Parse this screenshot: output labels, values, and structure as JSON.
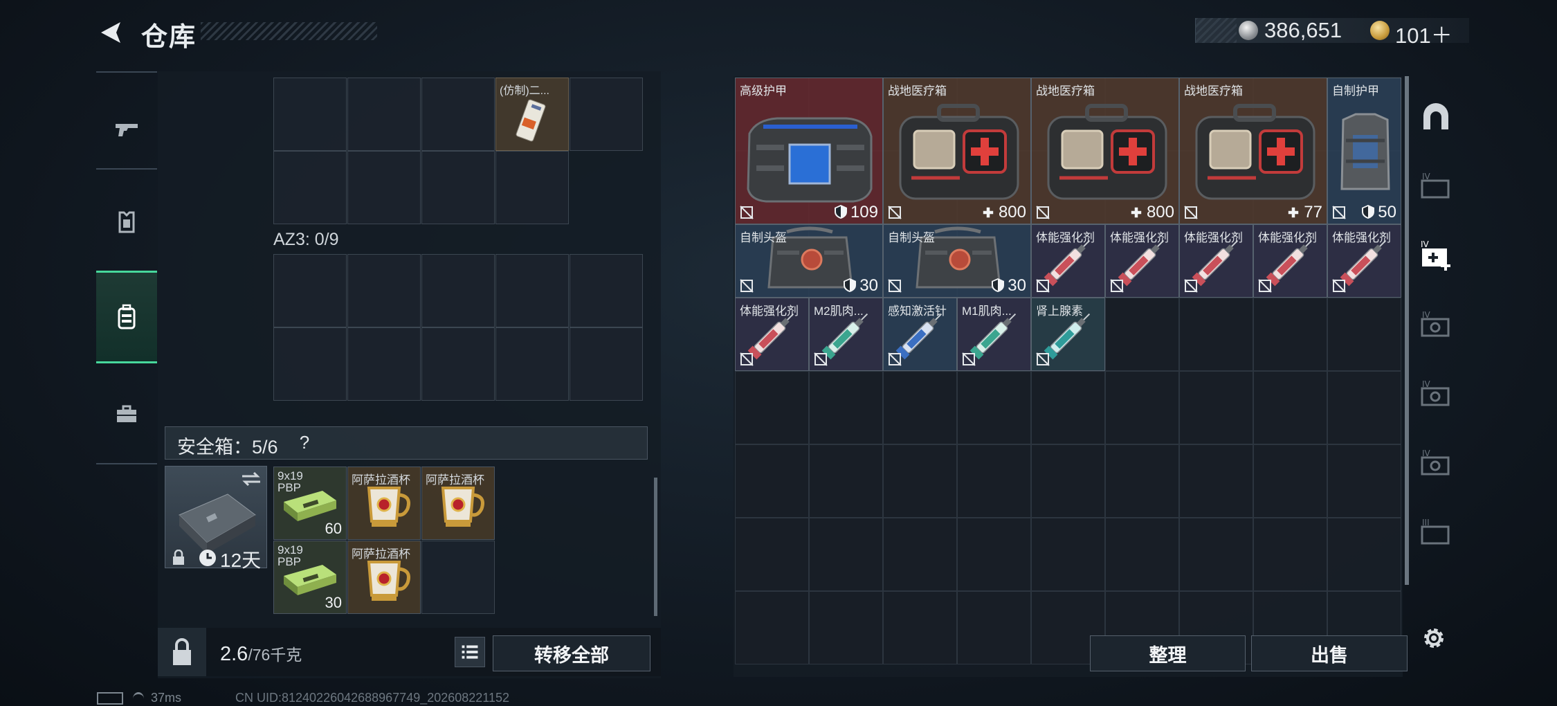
{
  "header": {
    "title": "仓库",
    "silver": "386,651",
    "gold": "101＋"
  },
  "left_tabs": [
    "pistol-icon",
    "armor-icon",
    "backpack-icon",
    "toolbox-icon"
  ],
  "left": {
    "top_item_name": "(仿制)二...",
    "az3_label": "AZ3: 0/9",
    "safe_label": "安全箱：5/6",
    "safe_help": "?",
    "timer": "12天",
    "safe_items": [
      {
        "name": "9x19 PBP",
        "count": "60"
      },
      {
        "name": "阿萨拉酒杯",
        "count": ""
      },
      {
        "name": "阿萨拉酒杯",
        "count": ""
      },
      {
        "name": "9x19 PBP",
        "count": "30"
      },
      {
        "name": "阿萨拉酒杯",
        "count": ""
      }
    ],
    "weight_value": "2.6",
    "weight_unit": "/76千克",
    "transfer_all": "转移全部"
  },
  "right": {
    "items": [
      {
        "name": "高级护甲",
        "val": "109",
        "val_icon": "shield"
      },
      {
        "name": "战地医疗箱",
        "val": "800",
        "val_icon": "plus"
      },
      {
        "name": "战地医疗箱",
        "val": "800",
        "val_icon": "plus"
      },
      {
        "name": "战地医疗箱",
        "val": "77",
        "val_icon": "plus"
      },
      {
        "name": "自制护甲",
        "val": "50",
        "val_icon": "shield"
      },
      {
        "name": "自制头盔",
        "val": "30",
        "val_icon": "shield"
      },
      {
        "name": "自制头盔",
        "val": "30",
        "val_icon": "shield"
      },
      {
        "name": "体能强化剂",
        "val": ""
      },
      {
        "name": "体能强化剂",
        "val": ""
      },
      {
        "name": "体能强化剂",
        "val": ""
      },
      {
        "name": "体能强化剂",
        "val": ""
      },
      {
        "name": "体能强化剂",
        "val": ""
      },
      {
        "name": "体能强化剂",
        "val": ""
      },
      {
        "name": "M2肌肉...",
        "val": ""
      },
      {
        "name": "感知激活针",
        "val": ""
      },
      {
        "name": "M1肌肉...",
        "val": ""
      },
      {
        "name": "肾上腺素",
        "val": ""
      }
    ],
    "sort": "整理",
    "sell": "出售"
  },
  "right_tabs": [
    "IV",
    "IV",
    "IV",
    "IV",
    "IV",
    "III"
  ],
  "footer": {
    "ping": "37ms",
    "uid": "CN UID:81240226042688967749_202608221152"
  }
}
